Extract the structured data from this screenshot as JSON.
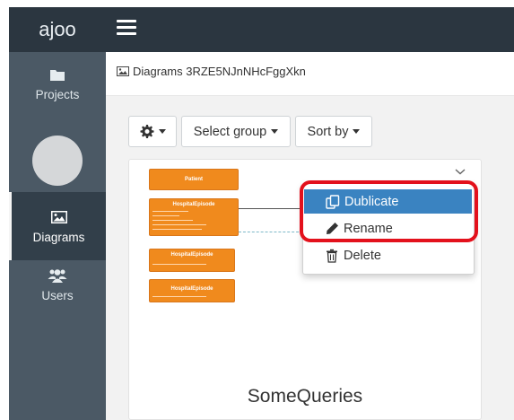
{
  "app": {
    "brand": "ajoo"
  },
  "sidebar": {
    "items": [
      {
        "label": "Projects",
        "icon": "folder-icon"
      },
      {
        "label": "Diagrams",
        "icon": "image-icon",
        "active": true
      },
      {
        "label": "Users",
        "icon": "users-icon"
      }
    ]
  },
  "breadcrumb": {
    "text": "Diagrams 3RZE5NJnNHcFggXkn",
    "icon": "image-icon"
  },
  "toolbar": {
    "settings_icon": "gear-icon",
    "select_group_label": "Select group",
    "sort_by_label": "Sort by"
  },
  "card": {
    "title": "SomeQueries",
    "diagram": {
      "entities": [
        "Patient",
        "HospitalEpisode",
        "HospitalEpisode",
        "HospitalEpisode"
      ]
    }
  },
  "context_menu": {
    "items": [
      {
        "label": "Dublicate",
        "icon": "duplicate-icon",
        "highlighted": true
      },
      {
        "label": "Rename",
        "icon": "pencil-icon"
      },
      {
        "label": "Delete",
        "icon": "trash-icon"
      }
    ]
  },
  "colors": {
    "topbar": "#2b3640",
    "sidebar": "#4b5965",
    "sidebar_active": "#323f4a",
    "menu_highlight": "#3a83c1",
    "annotation": "#e3111c",
    "entity": "#f08a1d"
  }
}
